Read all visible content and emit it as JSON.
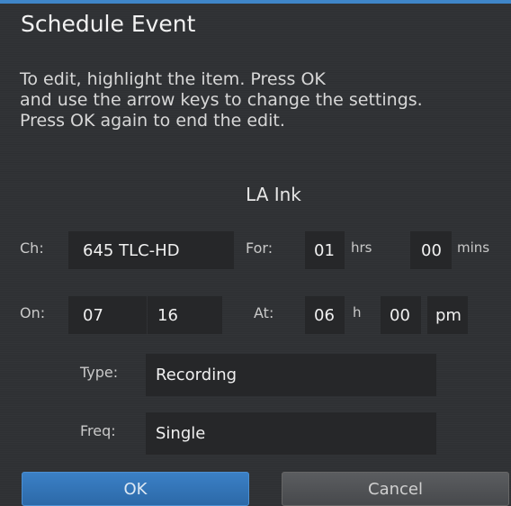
{
  "dialog": {
    "title": "Schedule Event",
    "instructions": [
      "To edit, highlight the item. Press OK",
      "and use the arrow keys to change the settings.",
      "Press OK again to end the edit."
    ],
    "program_name": "LA Ink"
  },
  "form": {
    "channel_label": "Ch:",
    "channel_value": "645 TLC-HD",
    "for_label": "For:",
    "duration_hours": "01",
    "hours_unit": "hrs",
    "duration_minutes": "00",
    "minutes_unit": "mins",
    "on_label": "On:",
    "month": "07",
    "day": "16",
    "at_label": "At:",
    "hour": "06",
    "hour_unit": "h",
    "minute": "00",
    "ampm": "pm",
    "type_label": "Type:",
    "type_value": "Recording",
    "freq_label": "Freq:",
    "freq_value": "Single"
  },
  "buttons": {
    "ok": "OK",
    "cancel": "Cancel"
  },
  "colors": {
    "accent": "#3f86c9",
    "background": "#2f3134",
    "field": "#262729"
  }
}
